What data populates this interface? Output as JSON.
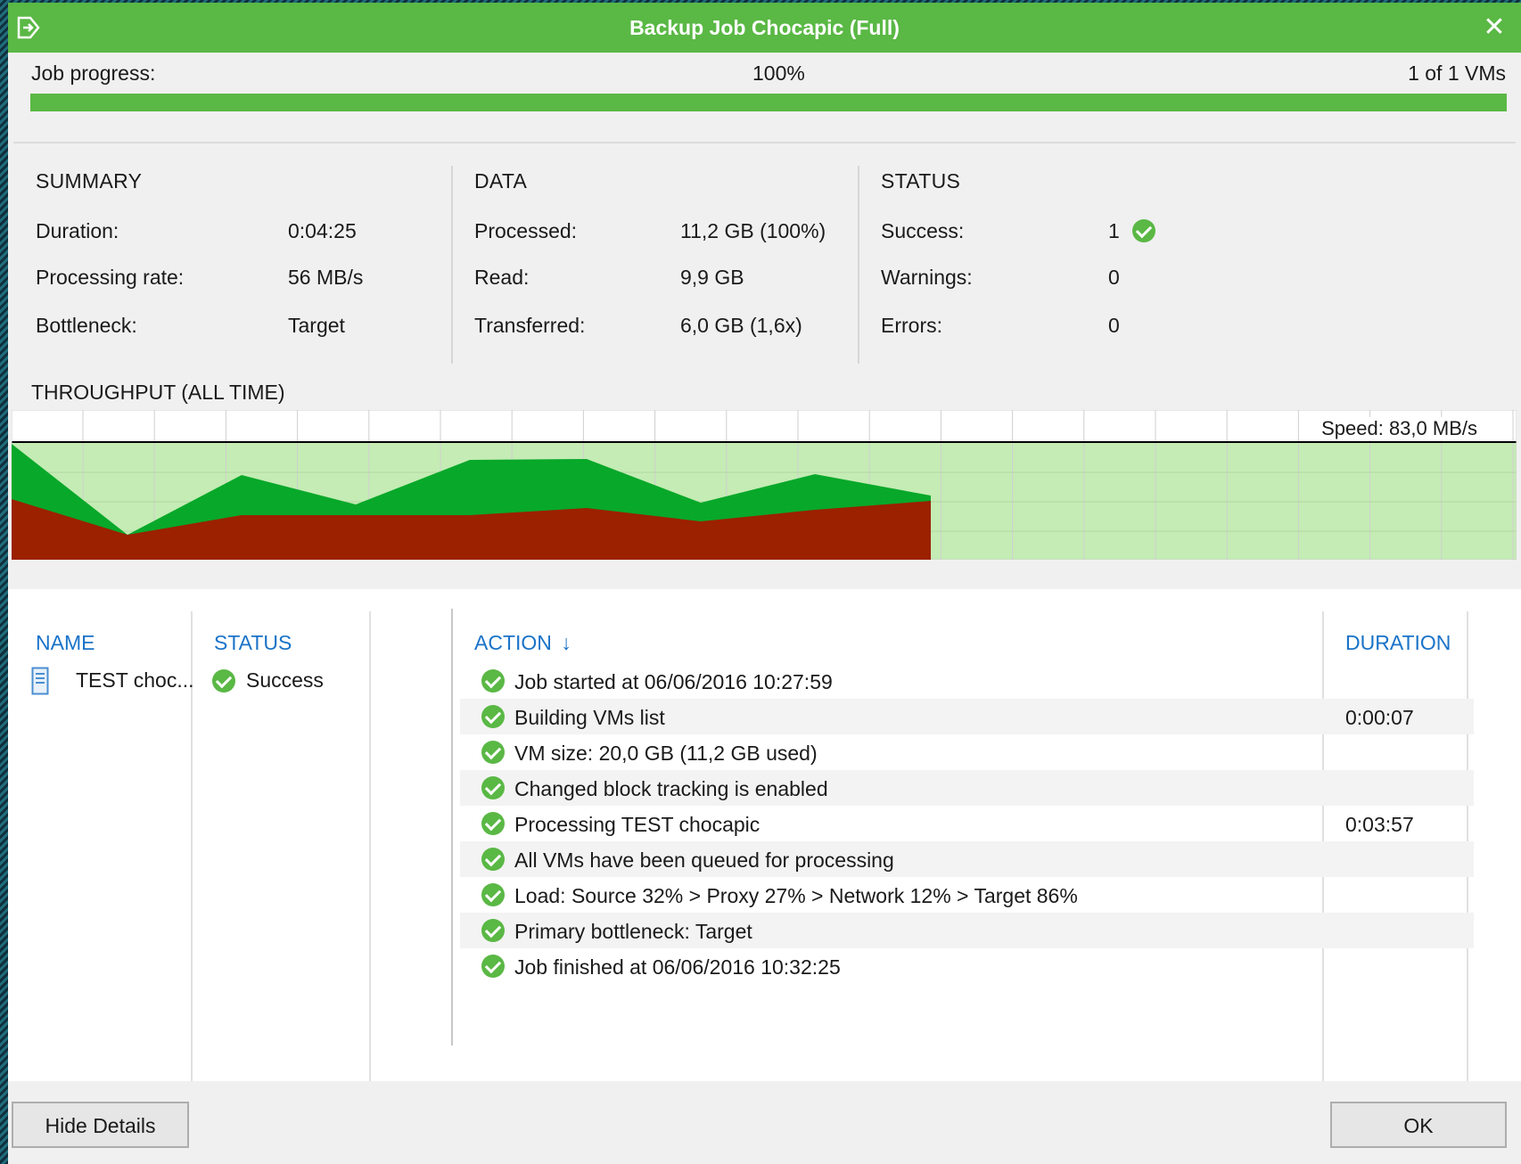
{
  "window": {
    "title": "Backup Job  Chocapic (Full)"
  },
  "progress": {
    "label": "Job progress:",
    "percent_text": "100%",
    "vms_text": "1 of 1 VMs",
    "value": 1.0
  },
  "summary": {
    "heading": "SUMMARY",
    "rows": [
      {
        "label": "Duration:",
        "value": "0:04:25"
      },
      {
        "label": "Processing rate:",
        "value": "56 MB/s"
      },
      {
        "label": "Bottleneck:",
        "value": "Target"
      }
    ]
  },
  "data": {
    "heading": "DATA",
    "rows": [
      {
        "label": "Processed:",
        "value": "11,2 GB (100%)"
      },
      {
        "label": "Read:",
        "value": "9,9 GB"
      },
      {
        "label": "Transferred:",
        "value": "6,0 GB (1,6x)"
      }
    ]
  },
  "status": {
    "heading": "STATUS",
    "rows": [
      {
        "label": "Success:",
        "value": "1"
      },
      {
        "label": "Warnings:",
        "value": "0"
      },
      {
        "label": "Errors:",
        "value": "0"
      }
    ]
  },
  "throughput": {
    "label": "THROUGHPUT (ALL TIME)",
    "speed_text": "Speed: 83,0 MB/s",
    "colors": {
      "read": "#08a82a",
      "transferred": "#9b2100",
      "background": "#c4ecb4"
    }
  },
  "columns": {
    "name": "NAME",
    "status": "STATUS",
    "action": "ACTION",
    "duration": "DURATION",
    "sort_arrow": "↓"
  },
  "vm": {
    "name": "TEST choc...",
    "status": "Success"
  },
  "actions": [
    {
      "text": "Job started at 06/06/2016 10:27:59",
      "duration": ""
    },
    {
      "text": "Building VMs list",
      "duration": "0:00:07"
    },
    {
      "text": "VM size: 20,0 GB (11,2 GB used)",
      "duration": ""
    },
    {
      "text": "Changed block tracking is enabled",
      "duration": ""
    },
    {
      "text": "Processing TEST chocapic",
      "duration": "0:03:57"
    },
    {
      "text": "All VMs have been queued for processing",
      "duration": ""
    },
    {
      "text": "Load: Source 32% > Proxy 27% > Network 12% > Target 86%",
      "duration": ""
    },
    {
      "text": "Primary bottleneck: Target",
      "duration": ""
    },
    {
      "text": "Job finished at 06/06/2016 10:32:25",
      "duration": ""
    }
  ],
  "buttons": {
    "hide_details": "Hide Details",
    "ok": "OK"
  }
}
